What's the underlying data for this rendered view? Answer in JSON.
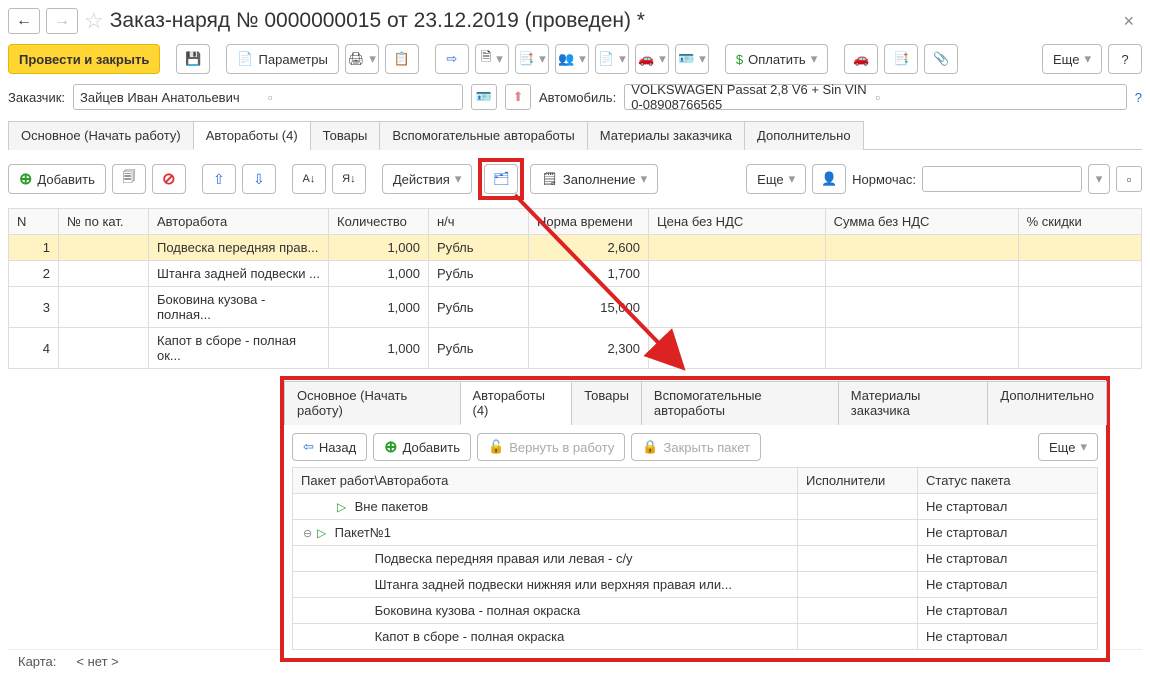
{
  "title": "Заказ-наряд № 0000000015  от 23.12.2019 (проведен) *",
  "toolbar": {
    "post_close": "Провести и закрыть",
    "params": "Параметры",
    "pay": "Оплатить",
    "more": "Еще"
  },
  "customer": {
    "label": "Заказчик:",
    "value": "Зайцев Иван Анатольевич"
  },
  "car": {
    "label": "Автомобиль:",
    "value": "VOLKSWAGEN Passat 2,8 V6 + Sin VIN 0-08908766565"
  },
  "tabs": {
    "t1": "Основное (Начать работу)",
    "t2": "Автоработы (4)",
    "t3": "Товары",
    "t4": "Вспомогательные автоработы",
    "t5": "Материалы заказчика",
    "t6": "Дополнительно"
  },
  "subbar": {
    "add": "Добавить",
    "actions": "Действия",
    "fill": "Заполнение",
    "more": "Еще",
    "normhour": "Нормочас:"
  },
  "columns": {
    "n": "N",
    "catno": "№ по кат.",
    "work": "Авторабота",
    "qty": "Количество",
    "nh": "н/ч",
    "timestd": "Норма времени",
    "price_novat": "Цена без НДС",
    "sum_novat": "Сумма без НДС",
    "discount": "% скидки"
  },
  "rows": [
    {
      "n": "1",
      "work": "Подвеска передняя прав...",
      "qty": "1,000",
      "nh": "Рубль",
      "norm": "2,600"
    },
    {
      "n": "2",
      "work": "Штанга задней подвески ...",
      "qty": "1,000",
      "nh": "Рубль",
      "norm": "1,700"
    },
    {
      "n": "3",
      "work": "Боковина кузова - полная...",
      "qty": "1,000",
      "nh": "Рубль",
      "norm": "15,000"
    },
    {
      "n": "4",
      "work": "Капот в сборе - полная ок...",
      "qty": "1,000",
      "nh": "Рубль",
      "norm": "2,300"
    }
  ],
  "card": {
    "label": "Карта:",
    "value": "< нет >"
  },
  "popup": {
    "tabs": {
      "t1": "Основное (Начать работу)",
      "t2": "Автоработы (4)",
      "t3": "Товары",
      "t4": "Вспомогательные автоработы",
      "t5": "Материалы заказчика",
      "t6": "Дополнительно"
    },
    "buttons": {
      "back": "Назад",
      "add": "Добавить",
      "return": "Вернуть в работу",
      "close_pkg": "Закрыть пакет",
      "more": "Еще"
    },
    "columns": {
      "pkg": "Пакет работ\\Авторабота",
      "exec": "Исполнители",
      "status": "Статус пакета"
    },
    "rows": [
      {
        "indent": 1,
        "icon": "play",
        "name": "Вне пакетов",
        "status": "Не стартовал",
        "toggle": ""
      },
      {
        "indent": 0,
        "icon": "play",
        "name": "Пакет№1",
        "status": "Не стартовал",
        "toggle": "⊖"
      },
      {
        "indent": 2,
        "icon": "",
        "name": "Подвеска передняя правая или левая - с/у",
        "status": "Не стартовал",
        "toggle": ""
      },
      {
        "indent": 2,
        "icon": "",
        "name": "Штанга задней подвески нижняя или верхняя правая или...",
        "status": "Не стартовал",
        "toggle": ""
      },
      {
        "indent": 2,
        "icon": "",
        "name": "Боковина кузова - полная окраска",
        "status": "Не стартовал",
        "toggle": ""
      },
      {
        "indent": 2,
        "icon": "",
        "name": "Капот в сборе - полная окраска",
        "status": "Не стартовал",
        "toggle": ""
      }
    ]
  }
}
